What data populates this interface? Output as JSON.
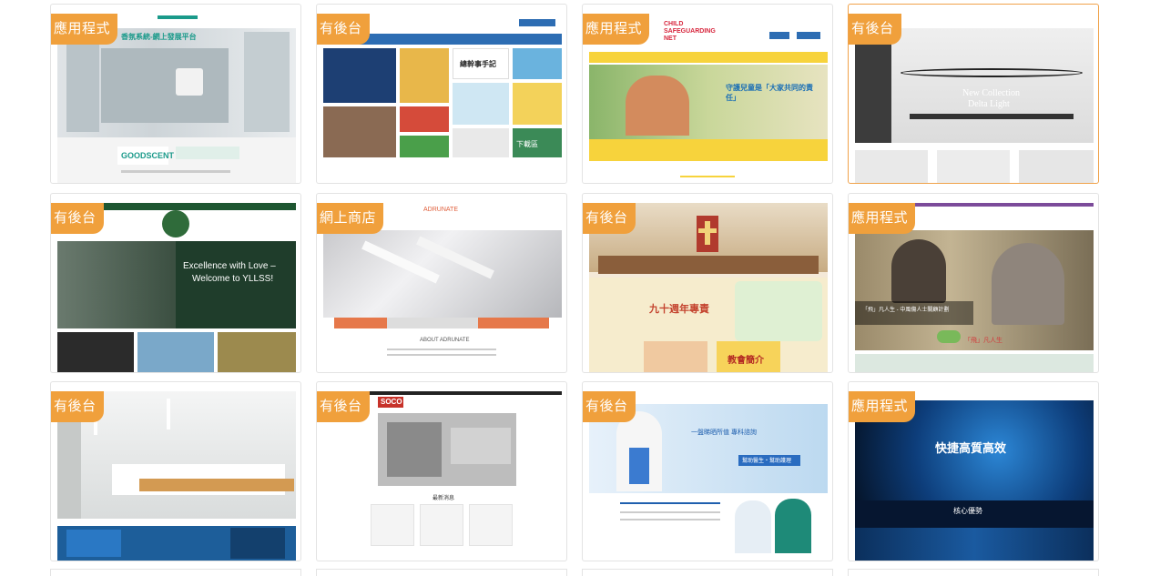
{
  "cards": [
    {
      "id": "card-1",
      "tag": "應用程式",
      "caption": "GOODSCENT",
      "headline": "香氛系統-網上發展平台"
    },
    {
      "id": "card-2",
      "tag": "有後台",
      "caption": "總幹事手記",
      "headline": "下載區"
    },
    {
      "id": "card-3",
      "tag": "應用程式",
      "caption": "CHILD SAFEGUARDING NET",
      "headline": "守護兒童是「大家共同的責任」"
    },
    {
      "id": "card-4",
      "tag": "有後台",
      "caption": "New Collection",
      "headline": "Delta Light"
    },
    {
      "id": "card-5",
      "tag": "有後台",
      "caption": "Excellence with Love –",
      "headline": "Welcome to YLLSS!"
    },
    {
      "id": "card-6",
      "tag": "網上商店",
      "caption": "ABOUT ADRUNATE",
      "headline": "ADRUNATE"
    },
    {
      "id": "card-7",
      "tag": "有後台",
      "caption": "九十週年專責",
      "headline": "教會簡介"
    },
    {
      "id": "card-8",
      "tag": "應用程式",
      "caption": "「飛」凡人生",
      "headline": "「飛」凡人生 - 中風傷人士關顧計劃"
    },
    {
      "id": "card-9",
      "tag": "有後台",
      "caption": "",
      "headline": ""
    },
    {
      "id": "card-10",
      "tag": "有後台",
      "caption": "最新消息",
      "headline": "SOCO"
    },
    {
      "id": "card-11",
      "tag": "有後台",
      "caption": "一盤睇晒所值 專科諮詢",
      "headline": "幫助醫生・幫助護理"
    },
    {
      "id": "card-12",
      "tag": "應用程式",
      "caption": "快捷高質高效",
      "headline": "核心優勢"
    }
  ],
  "colors": {
    "tag": "#f0a03c",
    "border": "#e3e3e3",
    "active_border": "#f0a24a"
  }
}
